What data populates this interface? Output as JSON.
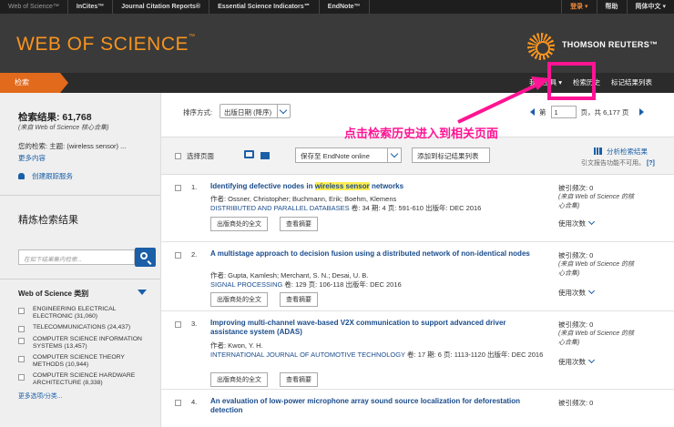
{
  "topnav": {
    "items": [
      "Web of Science™",
      "InCites™",
      "Journal Citation Reports®",
      "Essential Science Indicators℠",
      "EndNote™"
    ],
    "right": [
      "登录 ▾",
      "帮助",
      "简体中文 ▾"
    ]
  },
  "banner": {
    "brand": "WEB OF SCIENCE",
    "brand_tm": "™",
    "publisher": "THOMSON REUTERS™"
  },
  "tabs": {
    "search": "检索",
    "right": [
      "我的工具 ▾",
      "检索历史",
      "标记结果列表"
    ]
  },
  "sidebar": {
    "result_count": "检索结果: 61,768",
    "core_note": "(来自 Web of Science 核心合集)",
    "query": "您的检索: 主题: (wireless sensor) ...",
    "more": "更多内容",
    "alert": "创建跟踪服务",
    "refine_title": "精炼检索结果",
    "search_placeholder": "在如下结果集内检索...",
    "category_title": "Web of Science 类别",
    "categories": [
      "ENGINEERING ELECTRICAL ELECTRONIC (31,060)",
      "TELECOMMUNICATIONS (24,437)",
      "COMPUTER SCIENCE INFORMATION SYSTEMS (13,457)",
      "COMPUTER SCIENCE THEORY METHODS (10,944)",
      "COMPUTER SCIENCE HARDWARE ARCHITECTURE (8,338)"
    ],
    "more_options": "更多选项/分类..."
  },
  "sortbar": {
    "label": "排序方式:",
    "value": "出版日期 (降序)",
    "page_prefix": "第",
    "page_value": "1",
    "page_suffix": "页，共 6,177 页"
  },
  "toolbar": {
    "select_page": "选择页面",
    "save": "保存至 EndNote online",
    "add_marked": "添加到标记结果列表",
    "analyze": "分析检索结果",
    "cite_note": "引文报告功能不可用。",
    "cite_help": "[?]"
  },
  "results": [
    {
      "num": "1.",
      "title_pre": "Identifying defective nodes in ",
      "title_hl": "wireless sensor",
      "title_post": " networks",
      "authors": "作者: Ossner, Christopher; Buchmann, Erik; Boehm, Klemens",
      "journal": "DISTRIBUTED AND PARALLEL DATABASES",
      "details": "  卷: 34  期: 4  页: 591-610  出版年: DEC 2016",
      "cited": "被引频次: 0",
      "cited_src": "(来自 Web of Science 的核心合集)",
      "usage": "使用次数",
      "btn_full": "出版商处的全文",
      "btn_abs": "查看摘要"
    },
    {
      "num": "2.",
      "title_pre": "A multistage approach to decision fusion using a distributed network of non-identical nodes",
      "title_hl": "",
      "title_post": "",
      "authors": "作者: Gupta, Kamlesh; Merchant, S. N.; Desai, U. B.",
      "journal": "SIGNAL PROCESSING",
      "details": "  卷: 129  页: 106-118  出版年: DEC 2016",
      "cited": "被引频次: 0",
      "cited_src": "(来自 Web of Science 的核心合集)",
      "usage": "使用次数",
      "btn_full": "出版商处的全文",
      "btn_abs": "查看摘要"
    },
    {
      "num": "3.",
      "title_pre": "Improving multi-channel wave-based V2X communication to support advanced driver assistance system (ADAS)",
      "title_hl": "",
      "title_post": "",
      "authors": "作者: Kwon, Y. H.",
      "journal": "INTERNATIONAL JOURNAL OF AUTOMOTIVE TECHNOLOGY",
      "details": "  卷: 17  期: 6  页: 1113-1120  出版年: DEC 2016",
      "cited": "被引频次: 0",
      "cited_src": "(来自 Web of Science 的核心合集)",
      "usage": "使用次数",
      "btn_full": "出版商处的全文",
      "btn_abs": "查看摘要"
    },
    {
      "num": "4.",
      "title_pre": "An evaluation of low-power microphone array sound source localization for deforestation detection",
      "title_hl": "",
      "title_post": "",
      "cited": "被引频次: 0"
    }
  ],
  "annotation": {
    "text": "点击检索历史进入到相关页面",
    "color": "#ff1493"
  },
  "colors": {
    "accent": "#f7941e",
    "tab": "#e26a1c",
    "link": "#1a5fa8",
    "highlight": "#ffee55"
  }
}
